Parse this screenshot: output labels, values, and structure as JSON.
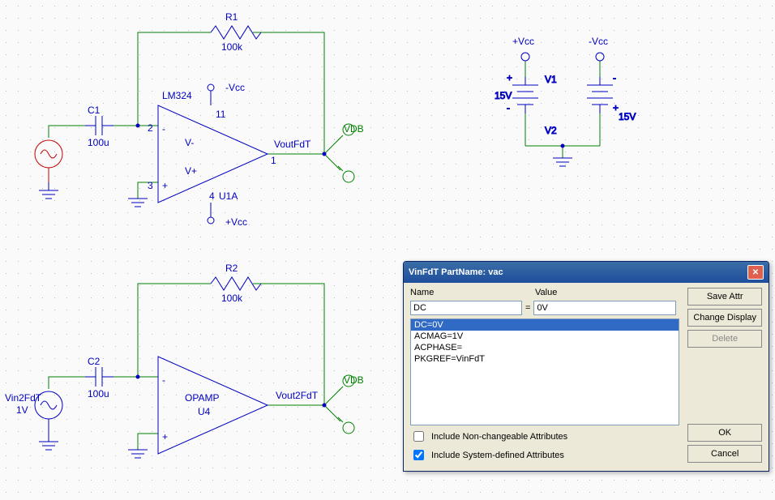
{
  "circuit1": {
    "r": {
      "ref": "R1",
      "val": "100k"
    },
    "c": {
      "ref": "C1",
      "val": "100u"
    },
    "opamp": {
      "part": "LM324",
      "ref": "U1A",
      "pins": {
        "inv": "2",
        "noninv": "3",
        "out": "1",
        "vp": "11",
        "vn": "4"
      }
    },
    "rails": {
      "neg": "-Vcc",
      "pos": "+Vcc"
    },
    "out": "VoutFdT"
  },
  "circuit2": {
    "r": {
      "ref": "R2",
      "val": "100k"
    },
    "c": {
      "ref": "C2",
      "val": "100u"
    },
    "opamp": {
      "part": "OPAMP",
      "ref": "U4"
    },
    "srcRef": "Vin2FdT",
    "srcVal": "1V",
    "out": "Vout2FdT"
  },
  "supply": {
    "pos": "+Vcc",
    "neg": "-Vcc",
    "v1": {
      "ref": "V1",
      "val": "15V"
    },
    "v2": {
      "ref": "V2",
      "val": "15V"
    }
  },
  "dialog": {
    "title": "VinFdT  PartName: vac",
    "nameLabel": "Name",
    "valueLabel": "Value",
    "nameField": "DC",
    "valueField": "0V",
    "items": [
      "DC=0V",
      "ACMAG=1V",
      "ACPHASE=",
      "PKGREF=VinFdT"
    ],
    "chk1": "Include Non-changeable Attributes",
    "chk2": "Include System-defined Attributes",
    "buttons": {
      "save": "Save Attr",
      "change": "Change Display",
      "del": "Delete",
      "ok": "OK",
      "cancel": "Cancel"
    }
  }
}
